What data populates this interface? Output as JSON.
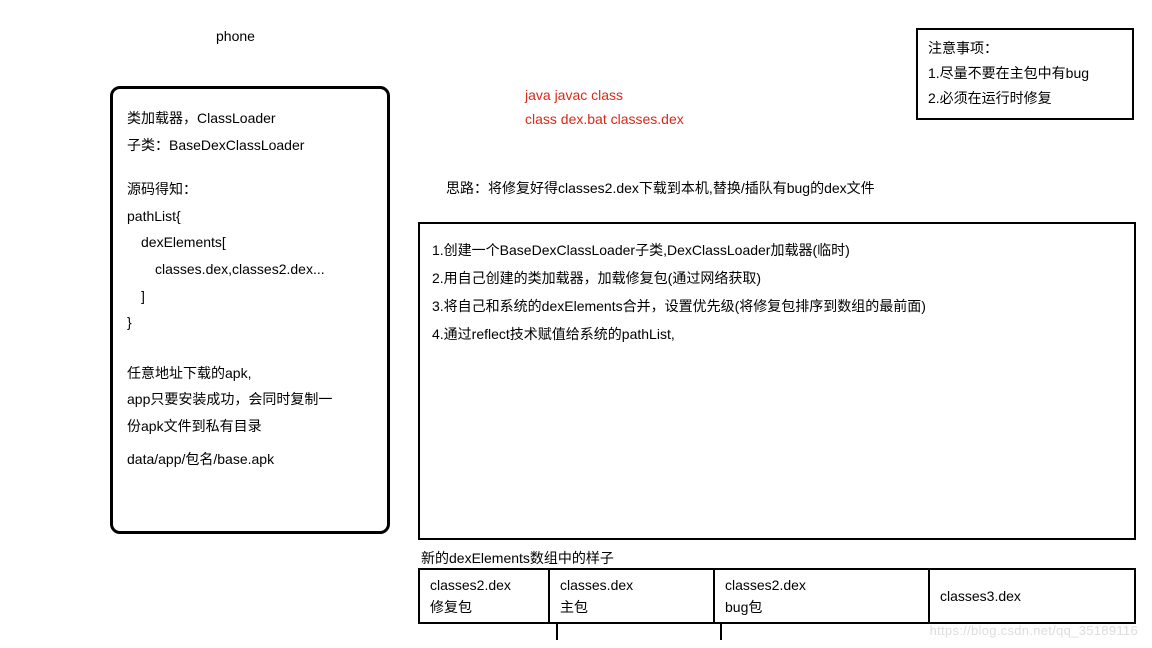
{
  "phone": {
    "title": "phone",
    "line1": "类加载器，ClassLoader",
    "line2": "子类：BaseDexClassLoader",
    "code": {
      "l1": "源码得知：",
      "l2": "pathList{",
      "l3": "dexElements[",
      "l4": "classes.dex,classes2.dex...",
      "l5": "]",
      "l6": "}"
    },
    "apk": {
      "l1": "任意地址下载的apk,",
      "l2": "app只要安装成功，会同时复制一",
      "l3": "份apk文件到私有目录",
      "l4": "data/app/包名/base.apk"
    }
  },
  "red": {
    "l1": "java   javac    class",
    "l2": "class   dex.bat   classes.dex"
  },
  "note": {
    "l1": "注意事项：",
    "l2": "1.尽量不要在主包中有bug",
    "l3": "2.必须在运行时修复"
  },
  "idea": "思路：将修复好得classes2.dex下载到本机,替换/插队有bug的dex文件",
  "steps": {
    "s1": "1.创建一个BaseDexClassLoader子类,DexClassLoader加载器(临时)",
    "s2": "2.用自己创建的类加载器，加载修复包(通过网络获取)",
    "s3": "3.将自己和系统的dexElements合并，设置优先级(将修复包排序到数组的最前面)",
    "s4": "4.通过reflect技术赋值给系统的pathList,"
  },
  "array": {
    "label": "新的dexElements数组中的样子",
    "cells": [
      {
        "a": "classes2.dex",
        "b": "修复包"
      },
      {
        "a": "classes.dex",
        "b": "主包"
      },
      {
        "a": "classes2.dex",
        "b": "bug包"
      },
      {
        "a": "classes3.dex",
        "b": ""
      }
    ]
  },
  "watermark": "https://blog.csdn.net/qq_35189116"
}
